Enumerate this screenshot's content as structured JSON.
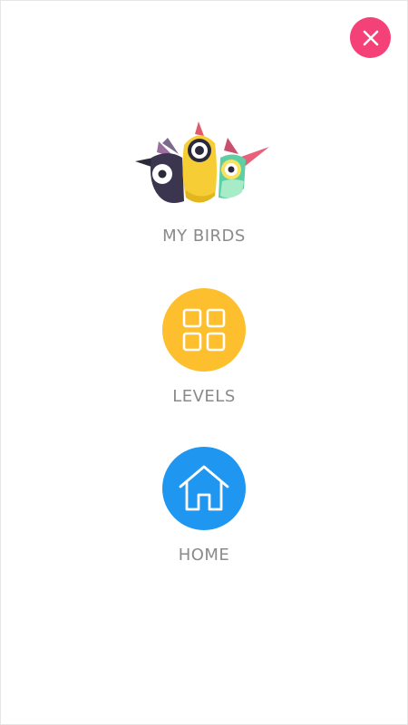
{
  "close_button": {
    "icon": "close-icon",
    "color": "#f44177"
  },
  "menu": {
    "items": [
      {
        "label": "MY BIRDS",
        "icon": "birds-icon"
      },
      {
        "label": "LEVELS",
        "icon": "grid-icon",
        "color": "#fdbf2e"
      },
      {
        "label": "HOME",
        "icon": "home-icon",
        "color": "#1f97f0"
      }
    ]
  },
  "colors": {
    "label": "#8a8a8a",
    "background": "#ffffff"
  }
}
